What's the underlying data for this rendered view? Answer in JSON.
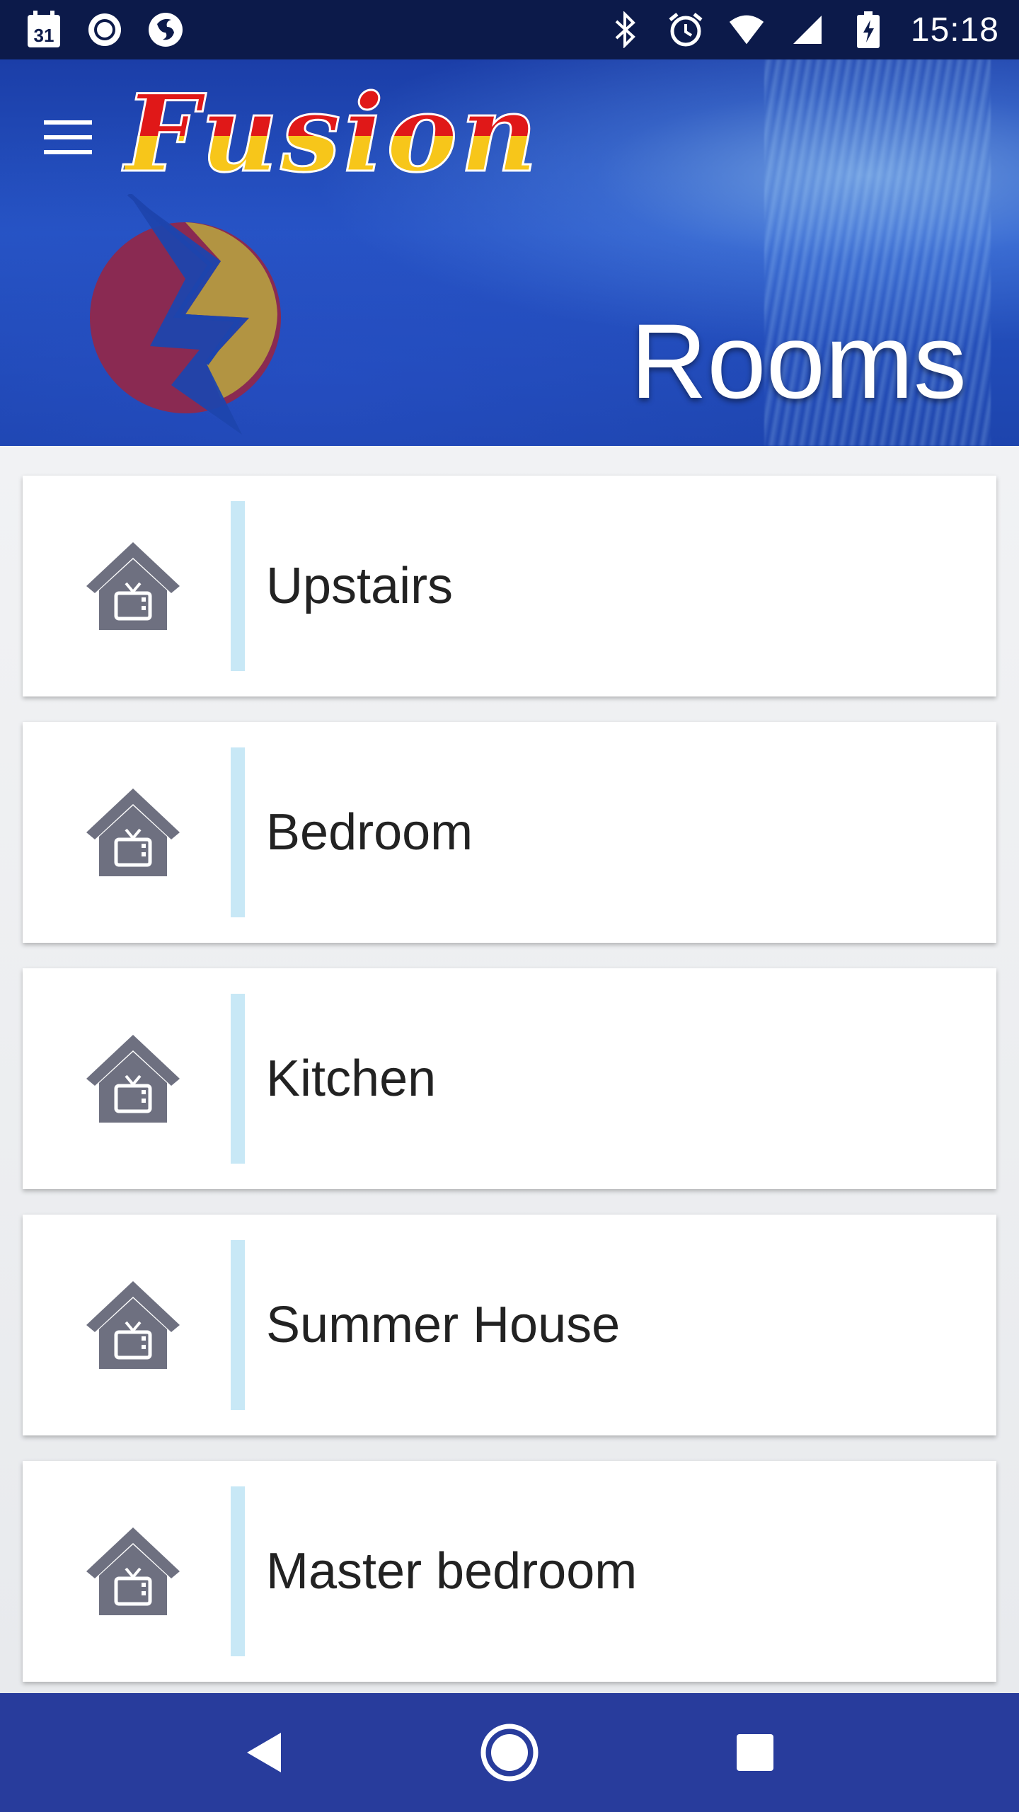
{
  "status_bar": {
    "time": "15:18",
    "calendar_day": "31",
    "left_icons": [
      "calendar-icon",
      "record-icon",
      "firefox-icon"
    ],
    "right_icons": [
      "bluetooth-icon",
      "alarm-icon",
      "wifi-icon",
      "cellular-icon",
      "battery-charging-icon"
    ]
  },
  "header": {
    "brand": "Fusion",
    "title": "Rooms",
    "menu_icon": "hamburger-menu-icon"
  },
  "rooms": [
    {
      "label": "Upstairs",
      "icon": "house-tv-icon"
    },
    {
      "label": "Bedroom",
      "icon": "house-tv-icon"
    },
    {
      "label": "Kitchen",
      "icon": "house-tv-icon"
    },
    {
      "label": "Summer House",
      "icon": "house-tv-icon"
    },
    {
      "label": "Master bedroom",
      "icon": "house-tv-icon"
    }
  ],
  "nav_bar": {
    "buttons": [
      "back-icon",
      "home-icon",
      "recents-icon"
    ]
  },
  "colors": {
    "header_blue": "#2654c4",
    "nav_bar": "#283c9c",
    "divider": "#c8e8f6",
    "icon_gray": "#6e7080",
    "brand_red": "#e01818",
    "brand_yellow": "#f7c61a"
  }
}
